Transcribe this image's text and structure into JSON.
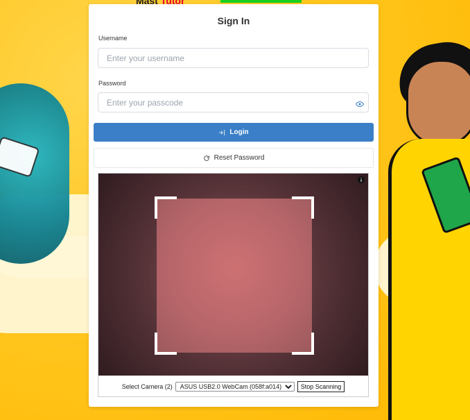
{
  "topbar": {
    "brand_prefix": "Mast",
    "brand_accent": "Tutor"
  },
  "form": {
    "title": "Sign In",
    "username": {
      "label": "Username",
      "placeholder": "Enter your username",
      "value": ""
    },
    "password": {
      "label": "Password",
      "placeholder": "Enter your passcode",
      "value": "",
      "toggle_icon": "eye-icon"
    },
    "login_button": {
      "label": "Login",
      "icon": "login-icon"
    },
    "reset_button": {
      "label": "Reset Password",
      "icon": "reset-icon"
    }
  },
  "scanner": {
    "info_icon": "info-icon",
    "camera_label": "Select Camera (2)",
    "camera_selected": "ASUS USB2.0 WebCam (058f:a014)",
    "stop_button": "Stop Scanning"
  },
  "colors": {
    "primary": "#3a7fc7",
    "background_yellow": "#ffc61f",
    "topbar_green": "#19d01f"
  }
}
